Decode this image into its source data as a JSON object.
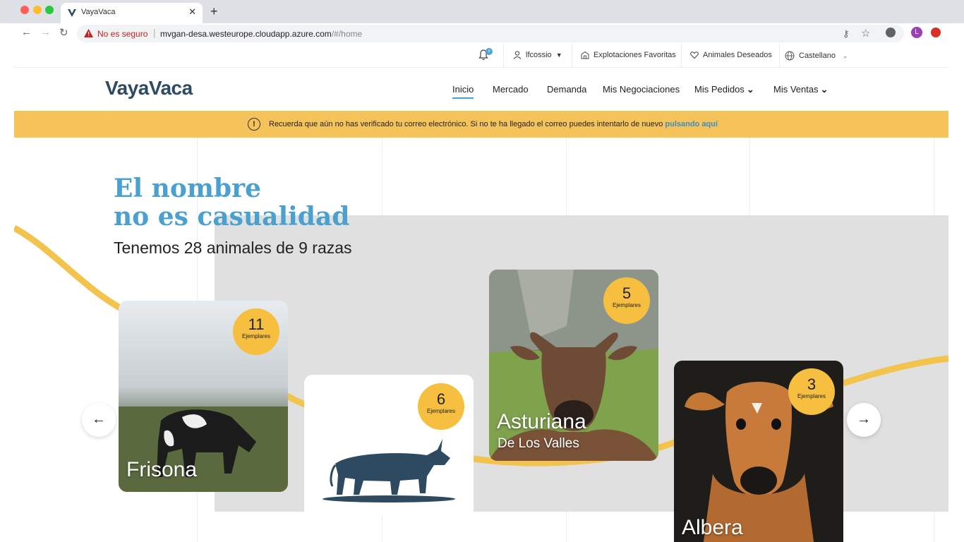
{
  "browser": {
    "tab_title": "VayaVaca",
    "security_label": "No es seguro",
    "url_host": "mvgan-desa.westeurope.cloudapp.azure.com",
    "url_path": "/#/home",
    "profile_initial": "L"
  },
  "utility_bar": {
    "notification_count": "0",
    "user": "lfcossio",
    "favorite_farms": "Explotaciones Favoritas",
    "wished_animals": "Animales Deseados",
    "language": "Castellano"
  },
  "nav": {
    "logo": "VayaVaca",
    "items": [
      "Inicio",
      "Mercado",
      "Demanda",
      "Mis Negociaciones",
      "Mis Pedidos",
      "Mis Ventas"
    ],
    "active": "Inicio"
  },
  "banner": {
    "icon": "!",
    "text": "Recuerda que aún no has verificado tu correo electrónico. Si no te ha llegado el correo puedes intentarlo de nuevo",
    "link": "pulsando aquí"
  },
  "hero": {
    "title_line1": "El nombre",
    "title_line2": "no es casualidad",
    "subtitle": "Tenemos 28 animales de 9 razas"
  },
  "cards": [
    {
      "name": "Frisona",
      "subname": "",
      "count": "11",
      "count_label": "Ejemplares"
    },
    {
      "name": "",
      "subname": "",
      "count": "6",
      "count_label": "Ejemplares"
    },
    {
      "name": "Asturiana",
      "subname": "De Los Valles",
      "count": "5",
      "count_label": "Ejemplares"
    },
    {
      "name": "Albera",
      "subname": "",
      "count": "3",
      "count_label": "Ejemplares"
    }
  ],
  "colors": {
    "accent_blue": "#4aa0cf",
    "logo_navy": "#2c4a63",
    "banner_yellow": "#f6c35a",
    "badge_yellow": "#f6bf3f"
  }
}
